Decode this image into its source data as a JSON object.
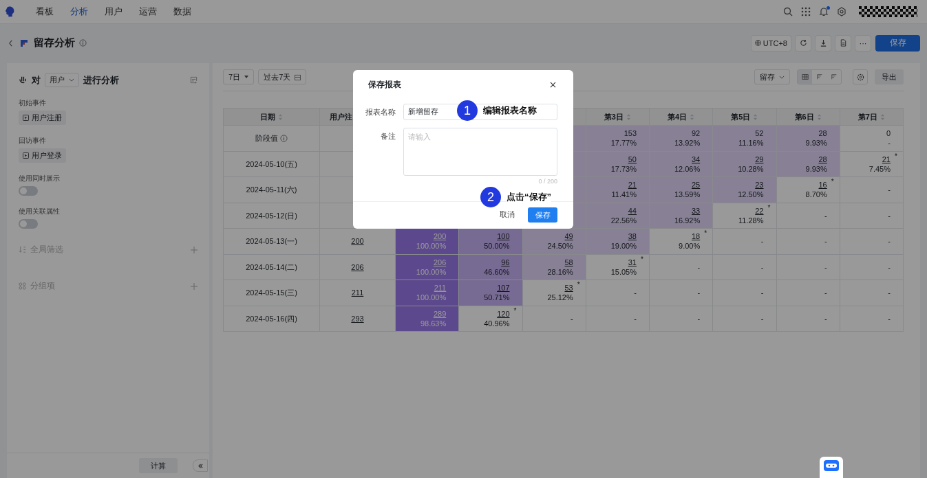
{
  "nav": {
    "tabs": [
      {
        "label": "看板",
        "selected": false
      },
      {
        "label": "分析",
        "selected": true
      },
      {
        "label": "用户",
        "selected": false
      },
      {
        "label": "运营",
        "selected": false
      },
      {
        "label": "数据",
        "selected": false
      }
    ],
    "notification": true
  },
  "header": {
    "title": "留存分析",
    "timezone": "UTC+8",
    "more": "···",
    "save": "保存"
  },
  "left": {
    "subject_prefix": "对",
    "subject": "用户",
    "subject_suffix": "进行分析",
    "events": [
      {
        "label": "初始事件",
        "value": "用户注册"
      },
      {
        "label": "回访事件",
        "value": "用户登录"
      }
    ],
    "toggles": [
      {
        "label": "使用同时展示",
        "on": false
      },
      {
        "label": "使用关联属性",
        "on": false
      }
    ],
    "sections": [
      {
        "label": "全局筛选",
        "kind": "filter"
      },
      {
        "label": "分组项",
        "kind": "group"
      }
    ],
    "calc": "计算"
  },
  "toolbar": {
    "period": "7日",
    "range": "过去7天",
    "metric": "留存",
    "views": [
      {
        "kind": "table",
        "selected": true
      },
      {
        "kind": "bars",
        "selected": false
      },
      {
        "kind": "steps",
        "selected": false
      }
    ],
    "export": "导出"
  },
  "table": {
    "columns": [
      {
        "label": "日期",
        "sortable": true
      },
      {
        "label": "用户注"
      },
      null,
      null,
      null,
      {
        "label": "第3日",
        "sortable": true
      },
      {
        "label": "第4日",
        "sortable": true
      },
      {
        "label": "第5日",
        "sortable": true
      },
      {
        "label": "第6日",
        "sortable": true
      },
      {
        "label": "第7日",
        "sortable": true
      }
    ],
    "rows": [
      {
        "kind": "summary",
        "cells": [
          {
            "text": "阶段值"
          },
          null,
          null,
          null,
          {
            "kind": "light"
          },
          {
            "count": "153",
            "pct": "17.77%",
            "kind": "light",
            "link": false
          },
          {
            "count": "92",
            "pct": "13.92%",
            "kind": "light",
            "link": false
          },
          {
            "count": "52",
            "pct": "11.16%",
            "kind": "light",
            "link": false
          },
          {
            "count": "28",
            "pct": "9.93%",
            "kind": "light",
            "link": false
          },
          {
            "count": "0",
            "pct": "-",
            "kind": "plain",
            "link": false
          }
        ]
      },
      {
        "kind": "date",
        "cells": [
          {
            "text": "2024-05-10(五)"
          },
          null,
          null,
          null,
          {
            "kind": "light"
          },
          {
            "count": "50",
            "pct": "17.73%",
            "kind": "light",
            "link": true
          },
          {
            "count": "34",
            "pct": "12.06%",
            "kind": "light",
            "link": true
          },
          {
            "count": "29",
            "pct": "10.28%",
            "kind": "light",
            "link": true
          },
          {
            "count": "28",
            "pct": "9.93%",
            "kind": "light",
            "link": true
          },
          {
            "count": "21",
            "pct": "7.45%",
            "kind": "plain",
            "link": true,
            "note": "*"
          }
        ]
      },
      {
        "kind": "date",
        "cells": [
          {
            "text": "2024-05-11(六)"
          },
          null,
          null,
          null,
          {
            "kind": "light"
          },
          {
            "count": "21",
            "pct": "11.41%",
            "kind": "light",
            "link": true
          },
          {
            "count": "25",
            "pct": "13.59%",
            "kind": "light",
            "link": true
          },
          {
            "count": "23",
            "pct": "12.50%",
            "kind": "light",
            "link": true
          },
          {
            "count": "16",
            "pct": "8.70%",
            "kind": "plain",
            "link": true,
            "note": "*"
          },
          {
            "count": "-",
            "kind": "plain",
            "link": false
          }
        ]
      },
      {
        "kind": "date",
        "cells": [
          {
            "text": "2024-05-12(日)"
          },
          null,
          null,
          null,
          {
            "kind": "light"
          },
          {
            "count": "44",
            "pct": "22.56%",
            "kind": "light",
            "link": true
          },
          {
            "count": "33",
            "pct": "16.92%",
            "kind": "light",
            "link": true
          },
          {
            "count": "22",
            "pct": "11.28%",
            "kind": "plain",
            "link": true,
            "note": "*"
          },
          {
            "count": "-",
            "kind": "plain",
            "link": false
          },
          {
            "count": "-",
            "kind": "plain",
            "link": false
          }
        ]
      },
      {
        "kind": "date",
        "cells": [
          {
            "text": "2024-05-13(一)"
          },
          {
            "count": "200",
            "kind": "plain",
            "link": true
          },
          {
            "count": "200",
            "pct": "100.00%",
            "kind": "dark",
            "link": true
          },
          {
            "count": "100",
            "pct": "50.00%",
            "kind": "mid",
            "link": true
          },
          {
            "count": "49",
            "pct": "24.50%",
            "kind": "light",
            "link": true
          },
          {
            "count": "38",
            "pct": "19.00%",
            "kind": "light",
            "link": true
          },
          {
            "count": "18",
            "pct": "9.00%",
            "kind": "plain",
            "link": true,
            "note": "*"
          },
          {
            "count": "-",
            "kind": "plain",
            "link": false
          },
          {
            "count": "-",
            "kind": "plain",
            "link": false
          },
          {
            "count": "-",
            "kind": "plain",
            "link": false
          }
        ]
      },
      {
        "kind": "date",
        "cells": [
          {
            "text": "2024-05-14(二)"
          },
          {
            "count": "206",
            "kind": "plain",
            "link": true
          },
          {
            "count": "206",
            "pct": "100.00%",
            "kind": "dark",
            "link": true
          },
          {
            "count": "96",
            "pct": "46.60%",
            "kind": "mid",
            "link": true
          },
          {
            "count": "58",
            "pct": "28.16%",
            "kind": "light",
            "link": true
          },
          {
            "count": "31",
            "pct": "15.05%",
            "kind": "plain",
            "link": true,
            "note": "*"
          },
          {
            "count": "-",
            "kind": "plain",
            "link": false
          },
          {
            "count": "-",
            "kind": "plain",
            "link": false
          },
          {
            "count": "-",
            "kind": "plain",
            "link": false
          },
          {
            "count": "-",
            "kind": "plain",
            "link": false
          }
        ]
      },
      {
        "kind": "date",
        "cells": [
          {
            "text": "2024-05-15(三)"
          },
          {
            "count": "211",
            "kind": "plain",
            "link": true
          },
          {
            "count": "211",
            "pct": "100.00%",
            "kind": "dark",
            "link": true
          },
          {
            "count": "107",
            "pct": "50.71%",
            "kind": "mid",
            "link": true
          },
          {
            "count": "53",
            "pct": "25.12%",
            "kind": "plain",
            "link": true,
            "note": "*"
          },
          {
            "count": "-",
            "kind": "plain",
            "link": false
          },
          {
            "count": "-",
            "kind": "plain",
            "link": false
          },
          {
            "count": "-",
            "kind": "plain",
            "link": false
          },
          {
            "count": "-",
            "kind": "plain",
            "link": false
          },
          {
            "count": "-",
            "kind": "plain",
            "link": false
          }
        ]
      },
      {
        "kind": "date",
        "cells": [
          {
            "text": "2024-05-16(四)"
          },
          {
            "count": "293",
            "kind": "plain",
            "link": true
          },
          {
            "count": "289",
            "pct": "98.63%",
            "kind": "dark",
            "link": true
          },
          {
            "count": "120",
            "pct": "40.96%",
            "kind": "plain",
            "link": true,
            "note": "*"
          },
          {
            "count": "-",
            "kind": "plain",
            "link": false
          },
          {
            "count": "-",
            "kind": "plain",
            "link": false
          },
          {
            "count": "-",
            "kind": "plain",
            "link": false
          },
          {
            "count": "-",
            "kind": "plain",
            "link": false
          },
          {
            "count": "-",
            "kind": "plain",
            "link": false
          },
          {
            "count": "-",
            "kind": "plain",
            "link": false
          }
        ]
      }
    ]
  },
  "modal": {
    "title": "保存报表",
    "name_label": "报表名称",
    "name_value": "新增留存",
    "note_label": "备注",
    "note_placeholder": "请输入",
    "counter": "0 / 200",
    "cancel": "取消",
    "confirm": "保存",
    "steps": [
      {
        "number": "1",
        "text": "编辑报表名称"
      },
      {
        "number": "2",
        "text": "点击“保存”"
      }
    ]
  }
}
